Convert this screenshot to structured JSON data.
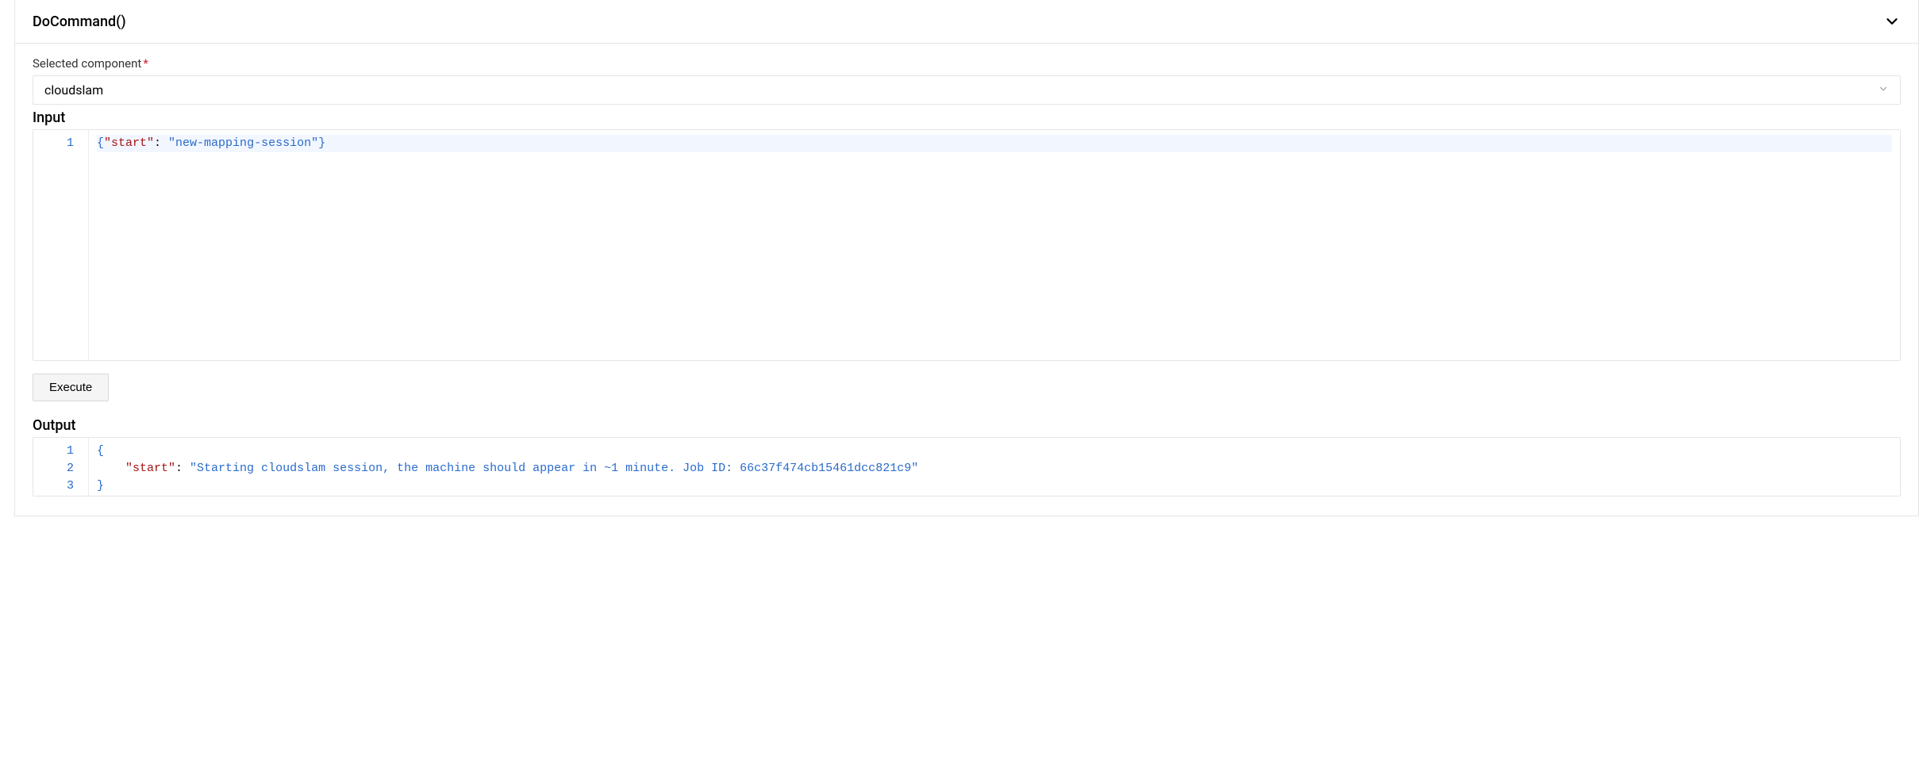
{
  "panel": {
    "title": "DoCommand()"
  },
  "selected_component": {
    "label": "Selected component",
    "value": "cloudslam"
  },
  "input": {
    "label": "Input",
    "lines": [
      {
        "n": "1",
        "tokens": [
          {
            "t": "brace",
            "v": "{"
          },
          {
            "t": "key",
            "v": "\"start\""
          },
          {
            "t": "punc",
            "v": ": "
          },
          {
            "t": "str",
            "v": "\"new-mapping-session\""
          },
          {
            "t": "brace",
            "v": "}"
          }
        ],
        "active": true
      }
    ]
  },
  "execute": {
    "label": "Execute"
  },
  "output": {
    "label": "Output",
    "lines": [
      {
        "n": "1",
        "tokens": [
          {
            "t": "brace",
            "v": "{"
          }
        ]
      },
      {
        "n": "2",
        "tokens": [
          {
            "t": "plain",
            "v": "    "
          },
          {
            "t": "key",
            "v": "\"start\""
          },
          {
            "t": "punc",
            "v": ": "
          },
          {
            "t": "str",
            "v": "\"Starting cloudslam session, the machine should appear in ~1 minute. Job ID: 66c37f474cb15461dcc821c9\""
          }
        ]
      },
      {
        "n": "3",
        "tokens": [
          {
            "t": "brace",
            "v": "}"
          }
        ]
      }
    ]
  }
}
